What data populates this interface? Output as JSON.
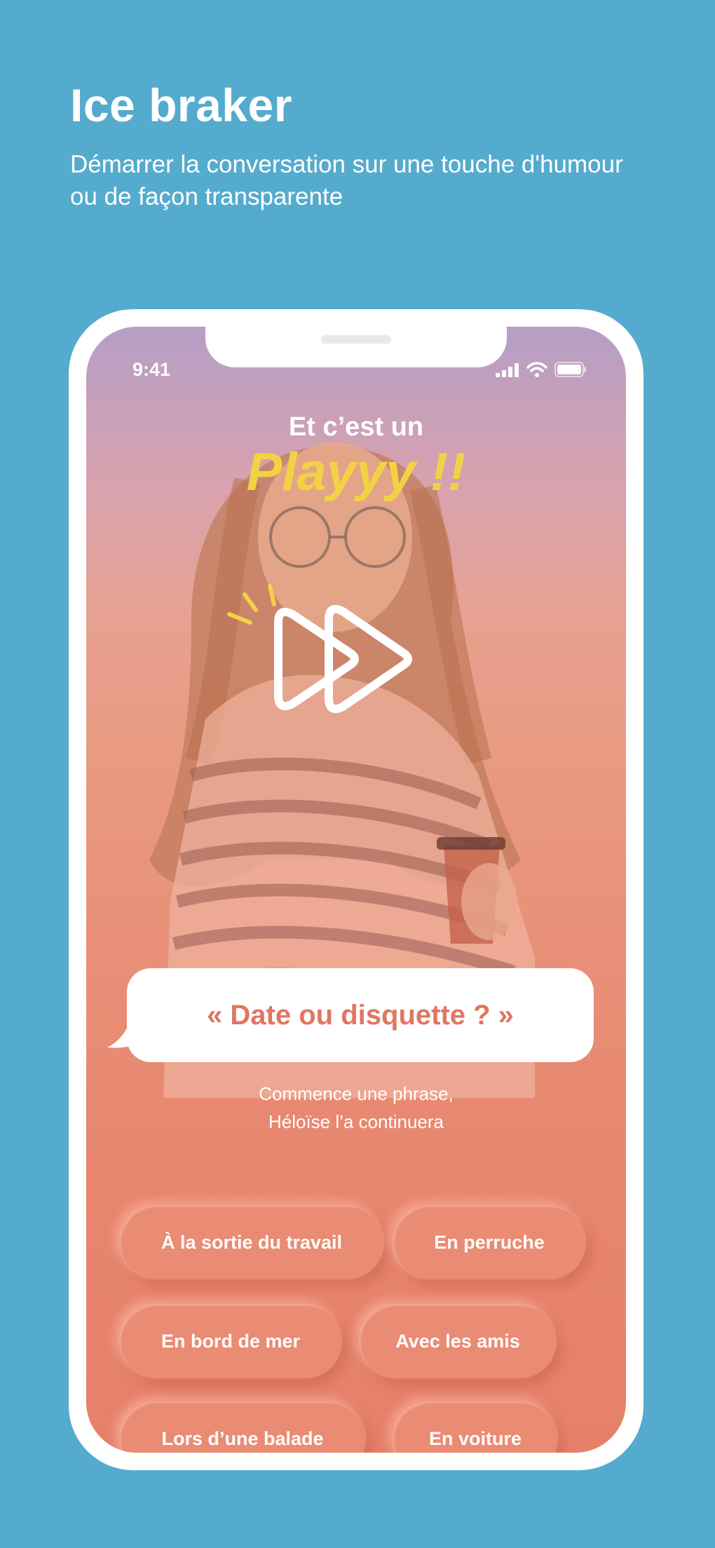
{
  "header": {
    "title": "Ice braker",
    "subtitle": "Démarrer la conversation sur une touche d'humour ou de façon transparente"
  },
  "status_bar": {
    "time": "9:41",
    "icons": [
      "signal-icon",
      "wifi-icon",
      "battery-icon"
    ]
  },
  "screen": {
    "title_small": "Et c’est un",
    "title_big": "Playyy !!",
    "prompt_bubble": "« Date ou disquette ? »",
    "caption_line1": "Commence une phrase,",
    "caption_line2": "Héloïse l’a continuera",
    "suggestions": [
      "À  la sortie du travail",
      "En perruche",
      "En bord de mer",
      "Avec les amis",
      "Lors d’une balade",
      "En voiture"
    ]
  },
  "colors": {
    "background": "#55abcd",
    "accent_yellow": "#f2d245",
    "coral": "#e8876f",
    "bubble_text": "#e0775f"
  }
}
